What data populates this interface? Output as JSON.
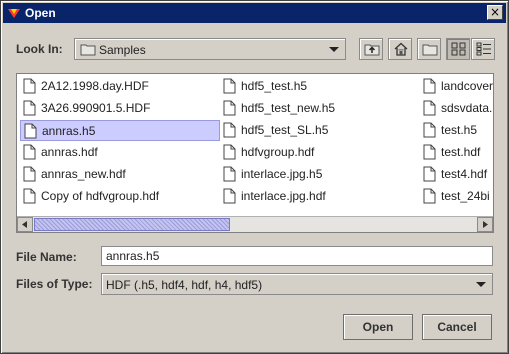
{
  "window": {
    "title": "Open",
    "close_glyph": "×"
  },
  "look_in": {
    "label": "Look In:",
    "value": "Samples"
  },
  "toolbar": [
    "up-one-level-icon",
    "home-icon",
    "new-folder-icon",
    "list-view-icon",
    "details-view-icon"
  ],
  "files": [
    [
      "2A12.1998.day.HDF",
      "3A26.990901.5.HDF",
      "annras.h5",
      "annras.hdf",
      "annras_new.hdf",
      "Copy of hdfvgroup.hdf"
    ],
    [
      "hdf5_test.h5",
      "hdf5_test_new.h5",
      "hdf5_test_SL.h5",
      "hdfvgroup.hdf",
      "interlace.jpg.h5",
      "interlace.jpg.hdf"
    ],
    [
      "landcover",
      "sdsvdata.",
      "test.h5",
      "test.hdf",
      "test4.hdf",
      "test_24bi"
    ]
  ],
  "selected_file": "annras.h5",
  "file_name": {
    "label": "File Name:",
    "value": "annras.h5"
  },
  "file_type": {
    "label": "Files of Type:",
    "value": "HDF (.h5, hdf4, hdf, h4, hdf5)"
  },
  "buttons": {
    "open": "Open",
    "cancel": "Cancel"
  },
  "colors": {
    "title_bar": "#0a246a",
    "selection": "#ccccff",
    "scroll_thumb": "#b4b4e8"
  }
}
